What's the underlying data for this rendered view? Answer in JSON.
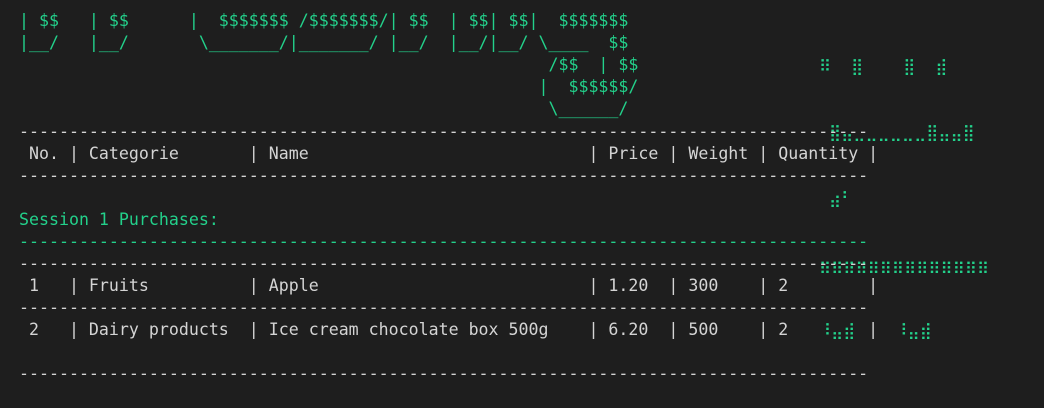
{
  "banner": {
    "line1": "| $$   | $$      |  $$$$$$$ /$$$$$$$/| $$  | $$| $$|  $$$$$$$",
    "line2": "|__/   |__/       \\_______/|_______/ |__/  |__/|__/ \\____  $$",
    "line3": "                                                     /$$  | $$",
    "line4": "                                                    |  $$$$$$/",
    "line5": "                                                     \\______/"
  },
  "art": {
    "line1": "⠿  ⣿    ⣿  ⣾",
    "line2": " ⣿⣤⣀⣀⣀⣀⣀⣀⣿⣤⣤⣿",
    "line3": " ⣴⠃",
    "line4": "⣶⣶⣶⣶⣶⣶⣶⣶⣶⣶⣶⣶⣶⣶",
    "line5": "⠸⣤⣾    ⠸⣤⣾"
  },
  "table": {
    "rule": "-------------------------------------------------------------------------------------",
    "header": " No. | Categorie       | Name                            | Price | Weight | Quantity |",
    "section_title": "Session 1 Purchases:",
    "rows": [
      " 1   | Fruits          | Apple                           | 1.20  | 300    | 2        |",
      " 2   | Dairy products  | Ice cream chocolate box 500g    | 6.20  | 500    | 2        |"
    ]
  },
  "colors": {
    "background": "#1e1e1e",
    "foreground": "#d4d4d4",
    "accent_green": "#23d18b"
  }
}
